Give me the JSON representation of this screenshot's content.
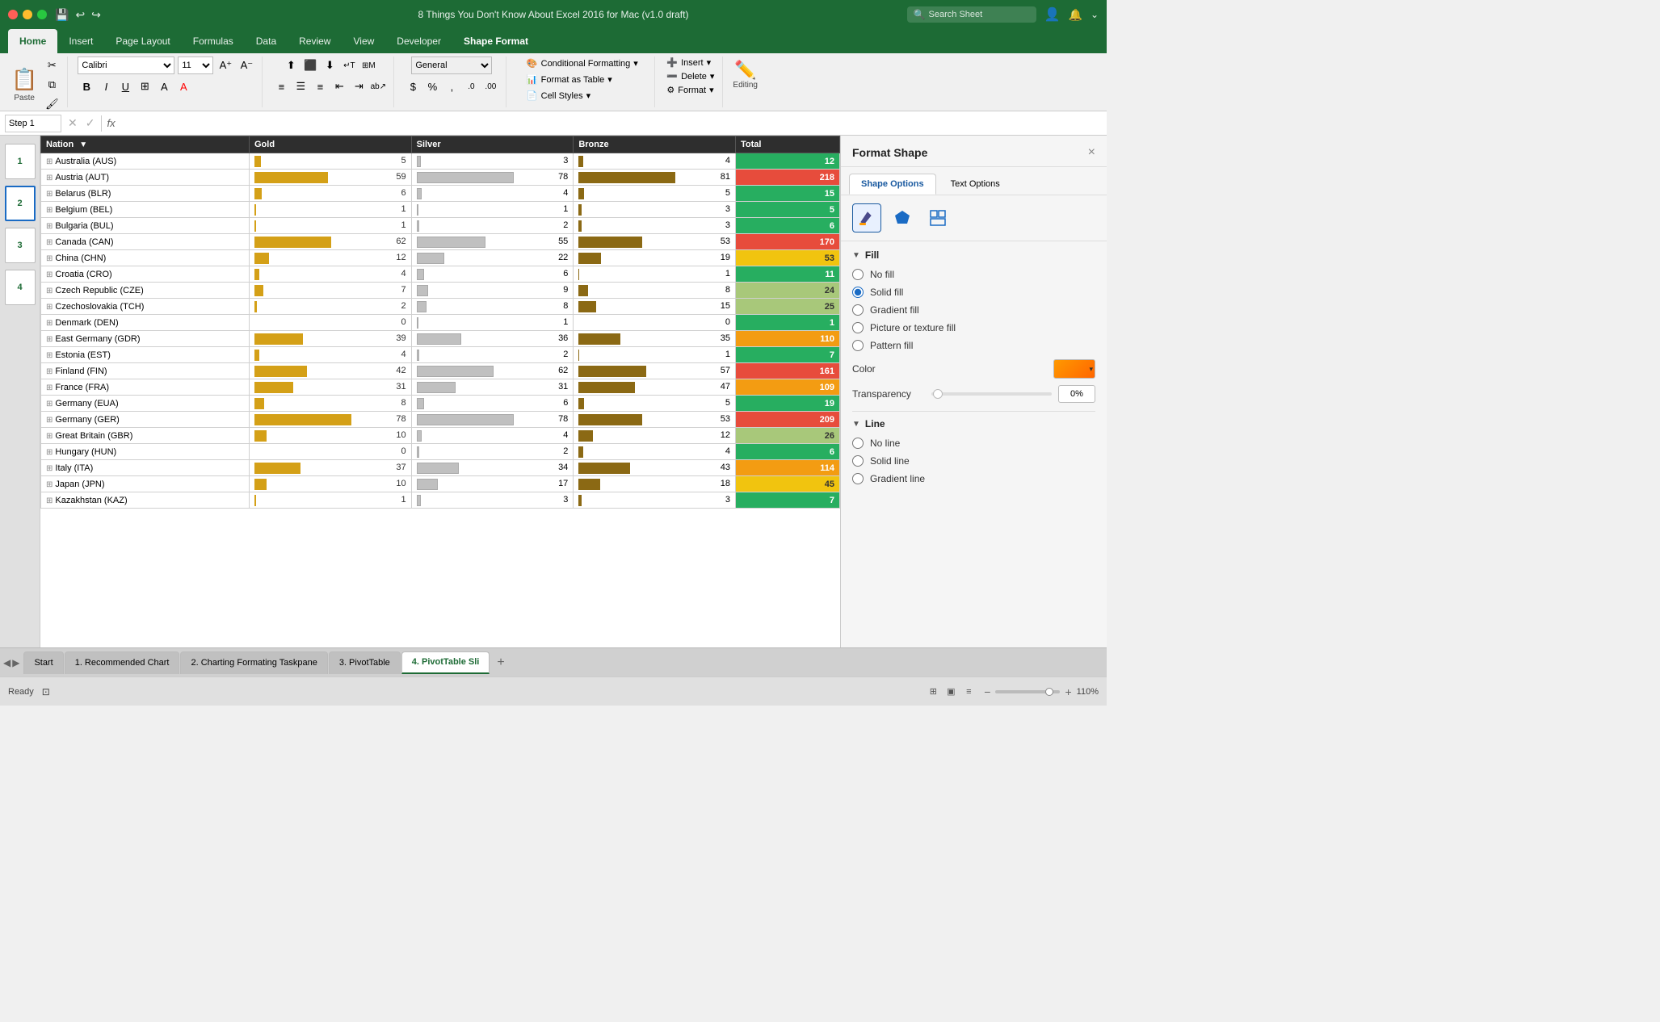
{
  "titlebar": {
    "title": "8 Things You Don't Know About Excel 2016 for Mac (v1.0 draft)",
    "search_placeholder": "Search Sheet"
  },
  "ribbon": {
    "tabs": [
      "Home",
      "Insert",
      "Page Layout",
      "Formulas",
      "Data",
      "Review",
      "View",
      "Developer",
      "Shape Format"
    ],
    "active_tab": "Home",
    "shape_format_tab": "Shape Format",
    "paste_label": "Paste",
    "font_name": "Calibri",
    "font_size": "1...",
    "bold": "B",
    "italic": "I",
    "underline": "U",
    "number_format": "General",
    "conditional_format": "Conditional Formatting",
    "format_table": "Format as Table",
    "cell_styles": "Cell Styles",
    "insert": "Insert",
    "delete": "Delete",
    "format": "Format",
    "editing": "Editing"
  },
  "formula_bar": {
    "name_box": "Step 1",
    "fx": "fx"
  },
  "table": {
    "headers": [
      "Nation",
      "Gold",
      "Silver",
      "Bronze",
      "Total"
    ],
    "rows": [
      {
        "nation": "Australia (AUS)",
        "gold": 5,
        "silver": 3,
        "bronze": 4,
        "total": 12,
        "total_class": "total-low"
      },
      {
        "nation": "Austria (AUT)",
        "gold": 59,
        "silver": 78,
        "bronze": 81,
        "total": 218,
        "total_class": "total-high"
      },
      {
        "nation": "Belarus (BLR)",
        "gold": 6,
        "silver": 4,
        "bronze": 5,
        "total": 15,
        "total_class": "total-low"
      },
      {
        "nation": "Belgium (BEL)",
        "gold": 1,
        "silver": 1,
        "bronze": 3,
        "total": 5,
        "total_class": "total-low"
      },
      {
        "nation": "Bulgaria (BUL)",
        "gold": 1,
        "silver": 2,
        "bronze": 3,
        "total": 6,
        "total_class": "total-low"
      },
      {
        "nation": "Canada (CAN)",
        "gold": 62,
        "silver": 55,
        "bronze": 53,
        "total": 170,
        "total_class": "total-high"
      },
      {
        "nation": "China (CHN)",
        "gold": 12,
        "silver": 22,
        "bronze": 19,
        "total": 53,
        "total_class": "total-med"
      },
      {
        "nation": "Croatia (CRO)",
        "gold": 4,
        "silver": 6,
        "bronze": 1,
        "total": 11,
        "total_class": "total-low"
      },
      {
        "nation": "Czech Republic (CZE)",
        "gold": 7,
        "silver": 9,
        "bronze": 8,
        "total": 24,
        "total_class": "total-low-med"
      },
      {
        "nation": "Czechoslovakia (TCH)",
        "gold": 2,
        "silver": 8,
        "bronze": 15,
        "total": 25,
        "total_class": "total-low-med"
      },
      {
        "nation": "Denmark (DEN)",
        "gold": 0,
        "silver": 1,
        "bronze": 0,
        "total": 1,
        "total_class": "total-low"
      },
      {
        "nation": "East Germany (GDR)",
        "gold": 39,
        "silver": 36,
        "bronze": 35,
        "total": 110,
        "total_class": "total-med-high"
      },
      {
        "nation": "Estonia (EST)",
        "gold": 4,
        "silver": 2,
        "bronze": 1,
        "total": 7,
        "total_class": "total-low"
      },
      {
        "nation": "Finland (FIN)",
        "gold": 42,
        "silver": 62,
        "bronze": 57,
        "total": 161,
        "total_class": "total-high"
      },
      {
        "nation": "France (FRA)",
        "gold": 31,
        "silver": 31,
        "bronze": 47,
        "total": 109,
        "total_class": "total-med-high"
      },
      {
        "nation": "Germany (EUA)",
        "gold": 8,
        "silver": 6,
        "bronze": 5,
        "total": 19,
        "total_class": "total-low"
      },
      {
        "nation": "Germany (GER)",
        "gold": 78,
        "silver": 78,
        "bronze": 53,
        "total": 209,
        "total_class": "total-high"
      },
      {
        "nation": "Great Britain (GBR)",
        "gold": 10,
        "silver": 4,
        "bronze": 12,
        "total": 26,
        "total_class": "total-low-med"
      },
      {
        "nation": "Hungary (HUN)",
        "gold": 0,
        "silver": 2,
        "bronze": 4,
        "total": 6,
        "total_class": "total-low"
      },
      {
        "nation": "Italy (ITA)",
        "gold": 37,
        "silver": 34,
        "bronze": 43,
        "total": 114,
        "total_class": "total-med-high"
      },
      {
        "nation": "Japan (JPN)",
        "gold": 10,
        "silver": 17,
        "bronze": 18,
        "total": 45,
        "total_class": "total-med"
      },
      {
        "nation": "Kazakhstan (KAZ)",
        "gold": 1,
        "silver": 3,
        "bronze": 3,
        "total": 7,
        "total_class": "total-low"
      }
    ]
  },
  "format_panel": {
    "title": "Format Shape",
    "close": "×",
    "tab_shape": "Shape Options",
    "tab_text": "Text Options",
    "fill_section": "Fill",
    "no_fill": "No fill",
    "solid_fill": "Solid fill",
    "gradient_fill": "Gradient fill",
    "picture_fill": "Picture or texture fill",
    "pattern_fill": "Pattern fill",
    "color_label": "Color",
    "transparency_label": "Transparency",
    "transparency_value": "0%",
    "line_section": "Line",
    "no_line": "No line",
    "solid_line": "Solid line",
    "gradient_line": "Gradient line"
  },
  "side_thumbs": [
    "1",
    "2",
    "3",
    "4"
  ],
  "sheet_tabs": [
    "Start",
    "1. Recommended Chart",
    "2. Charting Formating Taskpane",
    "3. PivotTable",
    "4. PivotTable Sli"
  ],
  "active_sheet": "4. PivotTable Sli",
  "statusbar": {
    "ready": "Ready",
    "zoom": "110%"
  }
}
